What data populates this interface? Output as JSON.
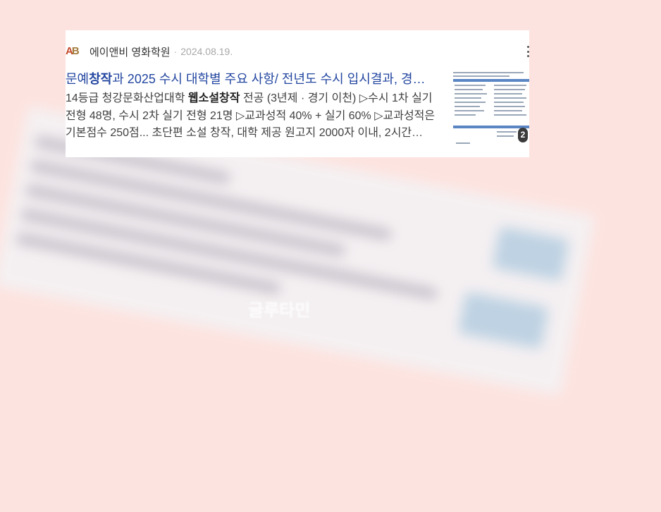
{
  "background": {
    "caption": "글루타민"
  },
  "result": {
    "source_name": "에이앤비 영화학원",
    "date": "2024.08.19.",
    "logo_text": "A&B",
    "title_pre": "문예",
    "title_em": "창작",
    "title_post": "과 2025 수시 대학별 주요 사항/ 전년도 수시 입시결과, 경…",
    "snippet_pre": "14등급 청강문화산업대학 ",
    "snippet_em": "웹소설창작",
    "snippet_post": " 전공 (3년제 · 경기 이천) ▷수시 1차 실기전형 48명, 수시 2차 실기 전형 21명 ▷교과성적 40% + 실기 60% ▷교과성적은 기본점수 250점... 초단편 소설 창작, 대학 제공 원고지 2000자 이내, 2시간…",
    "thumbnail_count": "2"
  },
  "colors": {
    "page_bg": "#fde3df",
    "title_link": "#2346a0",
    "snippet_text": "#404040",
    "date_text": "#a8a8a8"
  },
  "icons": {
    "more": "vertical-ellipsis-icon"
  }
}
